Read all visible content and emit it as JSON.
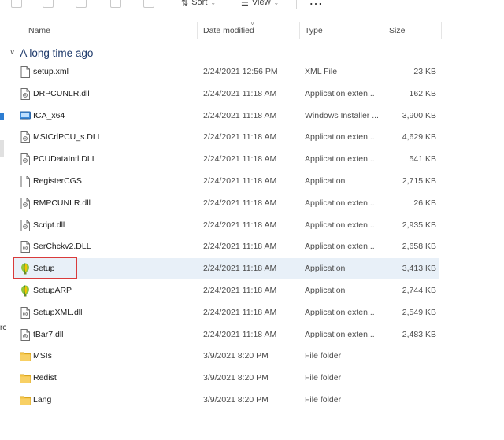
{
  "toolbar": {
    "sort_label": "Sort",
    "view_label": "View",
    "more_label": "…"
  },
  "columns": {
    "name": "Name",
    "date": "Date modified",
    "type": "Type",
    "size": "Size"
  },
  "group": {
    "label": "A long time ago"
  },
  "edge_text": "rc",
  "files": [
    {
      "name": "setup.xml",
      "date": "2/24/2021 12:56 PM",
      "type": "XML File",
      "size": "23 KB",
      "icon": "file-icon"
    },
    {
      "name": "DRPCUNLR.dll",
      "date": "2/24/2021 11:18 AM",
      "type": "Application exten...",
      "size": "162 KB",
      "icon": "dll-file-icon"
    },
    {
      "name": "ICA_x64",
      "date": "2/24/2021 11:18 AM",
      "type": "Windows Installer ...",
      "size": "3,900 KB",
      "icon": "installer-icon"
    },
    {
      "name": "MSICrlPCU_s.DLL",
      "date": "2/24/2021 11:18 AM",
      "type": "Application exten...",
      "size": "4,629 KB",
      "icon": "dll-file-icon"
    },
    {
      "name": "PCUDataIntl.DLL",
      "date": "2/24/2021 11:18 AM",
      "type": "Application exten...",
      "size": "541 KB",
      "icon": "dll-file-icon"
    },
    {
      "name": "RegisterCGS",
      "date": "2/24/2021 11:18 AM",
      "type": "Application",
      "size": "2,715 KB",
      "icon": "file-icon"
    },
    {
      "name": "RMPCUNLR.dll",
      "date": "2/24/2021 11:18 AM",
      "type": "Application exten...",
      "size": "26 KB",
      "icon": "dll-file-icon"
    },
    {
      "name": "Script.dll",
      "date": "2/24/2021 11:18 AM",
      "type": "Application exten...",
      "size": "2,935 KB",
      "icon": "dll-file-icon"
    },
    {
      "name": "SerChckv2.DLL",
      "date": "2/24/2021 11:18 AM",
      "type": "Application exten...",
      "size": "2,658 KB",
      "icon": "dll-file-icon"
    },
    {
      "name": "Setup",
      "date": "2/24/2021 11:18 AM",
      "type": "Application",
      "size": "3,413 KB",
      "icon": "balloon-app-icon"
    },
    {
      "name": "SetupARP",
      "date": "2/24/2021 11:18 AM",
      "type": "Application",
      "size": "2,744 KB",
      "icon": "balloon-app-icon"
    },
    {
      "name": "SetupXML.dll",
      "date": "2/24/2021 11:18 AM",
      "type": "Application exten...",
      "size": "2,549 KB",
      "icon": "dll-file-icon"
    },
    {
      "name": "tBar7.dll",
      "date": "2/24/2021 11:18 AM",
      "type": "Application exten...",
      "size": "2,483 KB",
      "icon": "dll-file-icon"
    },
    {
      "name": "MSIs",
      "date": "3/9/2021 8:20 PM",
      "type": "File folder",
      "size": "",
      "icon": "folder-icon"
    },
    {
      "name": "Redist",
      "date": "3/9/2021 8:20 PM",
      "type": "File folder",
      "size": "",
      "icon": "folder-icon"
    },
    {
      "name": "Lang",
      "date": "3/9/2021 8:20 PM",
      "type": "File folder",
      "size": "",
      "icon": "folder-icon"
    }
  ],
  "selected_index": 9,
  "colors": {
    "selection": "#e8f0f8",
    "highlight_border": "#d93b3b",
    "group_text": "#1e3a6b",
    "folder": "#f4c242"
  }
}
